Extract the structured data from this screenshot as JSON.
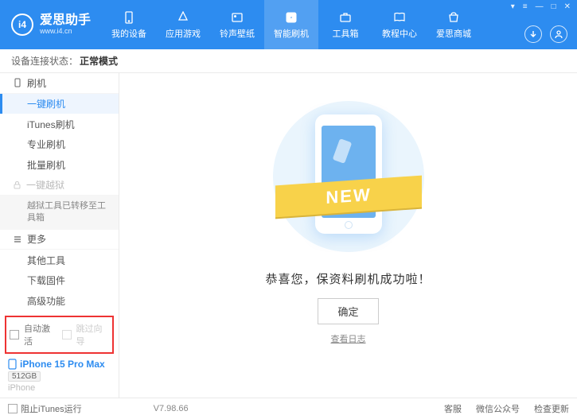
{
  "header": {
    "app_name": "爱思助手",
    "app_url": "www.i4.cn",
    "nav": [
      {
        "label": "我的设备"
      },
      {
        "label": "应用游戏"
      },
      {
        "label": "铃声壁纸"
      },
      {
        "label": "智能刷机"
      },
      {
        "label": "工具箱"
      },
      {
        "label": "教程中心"
      },
      {
        "label": "爱思商城"
      }
    ]
  },
  "status": {
    "label": "设备连接状态：",
    "value": "正常模式"
  },
  "sidebar": {
    "group1": {
      "title": "刷机",
      "items": [
        "一键刷机",
        "iTunes刷机",
        "专业刷机",
        "批量刷机"
      ]
    },
    "group2": {
      "title": "一键越狱",
      "sub": "越狱工具已转移至工具箱"
    },
    "group3": {
      "title": "更多",
      "items": [
        "其他工具",
        "下载固件",
        "高级功能"
      ]
    },
    "checks": {
      "auto_activate": "自动激活",
      "skip_guide": "跳过向导"
    },
    "device": {
      "name": "iPhone 15 Pro Max",
      "storage": "512GB",
      "type": "iPhone"
    }
  },
  "main": {
    "ribbon": "NEW",
    "message": "恭喜您，保资料刷机成功啦！",
    "ok": "确定",
    "view_log": "查看日志"
  },
  "footer": {
    "block_itunes": "阻止iTunes运行",
    "version": "V7.98.66",
    "links": [
      "客服",
      "微信公众号",
      "检查更新"
    ]
  }
}
